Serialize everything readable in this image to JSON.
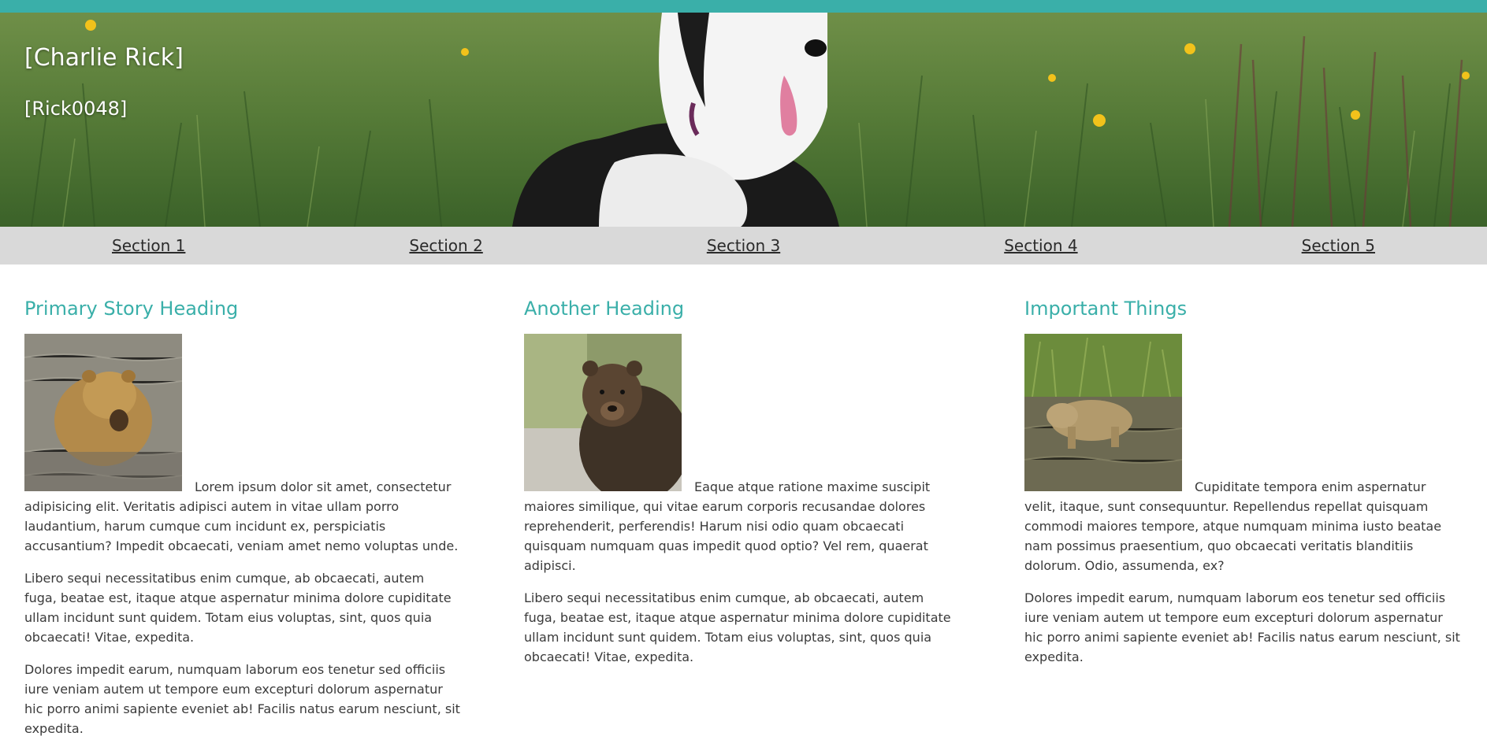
{
  "hero": {
    "title": "[Charlie Rick]",
    "subtitle": "[Rick0048]",
    "image": "dog-in-grass-photo"
  },
  "colors": {
    "accent": "#3aafa9",
    "nav_bg": "#d9d9d9",
    "text": "#3a3a3a"
  },
  "nav": {
    "items": [
      {
        "label": "Section 1"
      },
      {
        "label": "Section 2"
      },
      {
        "label": "Section 3"
      },
      {
        "label": "Section 4"
      },
      {
        "label": "Section 5"
      }
    ]
  },
  "columns": [
    {
      "heading": "Primary Story Heading",
      "image": "bear-in-water-photo",
      "paragraphs": [
        "Lorem ipsum dolor sit amet, consectetur adipisicing elit. Veritatis adipisci autem in vitae ullam porro laudantium, harum cumque cum incidunt ex, perspiciatis accusantium? Impedit obcaecati, veniam amet nemo voluptas unde.",
        "Libero sequi necessitatibus enim cumque, ab obcaecati, autem fuga, beatae est, itaque atque aspernatur minima dolore cupiditate ullam incidunt sunt quidem. Totam eius voluptas, sint, quos quia obcaecati! Vitae, expedita.",
        "Dolores impedit earum, numquam laborum eos tenetur sed officiis iure veniam autem ut tempore eum excepturi dolorum aspernatur hic porro animi sapiente eveniet ab! Facilis natus earum nesciunt, sit expedita."
      ]
    },
    {
      "heading": "Another Heading",
      "image": "brown-bear-sitting-photo",
      "paragraphs": [
        "Eaque atque ratione maxime suscipit maiores similique, qui vitae earum corporis recusandae dolores reprehenderit, perferendis! Harum nisi odio quam obcaecati quisquam numquam quas impedit quod optio? Vel rem, quaerat adipisci.",
        "Libero sequi necessitatibus enim cumque, ab obcaecati, autem fuga, beatae est, itaque atque aspernatur minima dolore cupiditate ullam incidunt sunt quidem. Totam eius voluptas, sint, quos quia obcaecati! Vitae, expedita."
      ]
    },
    {
      "heading": "Important Things",
      "image": "bear-wading-stream-photo",
      "paragraphs": [
        "Cupiditate tempora enim aspernatur velit, itaque, sunt consequuntur. Repellendus repellat quisquam commodi maiores tempore, atque numquam minima iusto beatae nam possimus praesentium, quo obcaecati veritatis blanditiis dolorum. Odio, assumenda, ex?",
        "Dolores impedit earum, numquam laborum eos tenetur sed officiis iure veniam autem ut tempore eum excepturi dolorum aspernatur hic porro animi sapiente eveniet ab! Facilis natus earum nesciunt, sit expedita."
      ]
    }
  ]
}
